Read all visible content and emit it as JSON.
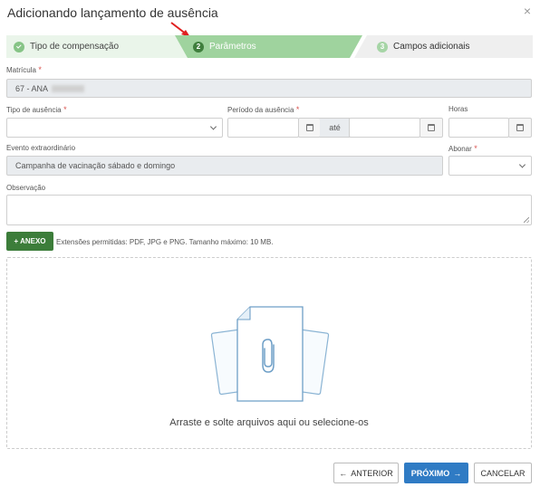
{
  "dialog": {
    "title": "Adicionando lançamento de ausência",
    "close_glyph": "×"
  },
  "steps": [
    {
      "label": "Tipo de compensação",
      "number": "",
      "state": "done"
    },
    {
      "label": "Parâmetros",
      "number": "2",
      "state": "active"
    },
    {
      "label": "Campos adicionais",
      "number": "3",
      "state": "pending"
    }
  ],
  "fields": {
    "matricula": {
      "label": "Matrícula",
      "value": "67 - ANA"
    },
    "tipo_ausencia": {
      "label": "Tipo de ausência",
      "value": ""
    },
    "periodo": {
      "label": "Período da ausência",
      "separator": "até",
      "start": "",
      "end": ""
    },
    "horas": {
      "label": "Horas",
      "value": ""
    },
    "evento": {
      "label": "Evento extraordinário",
      "value": "Campanha de vacinação sábado e domingo"
    },
    "abonar": {
      "label": "Abonar",
      "value": ""
    },
    "observacao": {
      "label": "Observação",
      "value": ""
    }
  },
  "attachments": {
    "button_label": "+ ANEXO",
    "extensions_text": "Extensões permitidas: PDF, JPG e PNG. Tamanho máximo: 10 MB.",
    "dropzone_text": "Arraste e solte arquivos aqui ou selecione-os"
  },
  "footer": {
    "previous_label": "ANTERIOR",
    "next_label": "PRÓXIMO",
    "cancel_label": "CANCELAR"
  },
  "icons": [
    "close-icon",
    "check-icon",
    "calendar-icon",
    "chevron-down-icon",
    "file-paperclip-icon",
    "arrow-left-icon",
    "arrow-right-icon"
  ],
  "colors": {
    "accent_green": "#3c7d3a",
    "step_active": "#9fd39e",
    "primary_blue": "#2f7bc4",
    "required_red": "#d9534f"
  }
}
